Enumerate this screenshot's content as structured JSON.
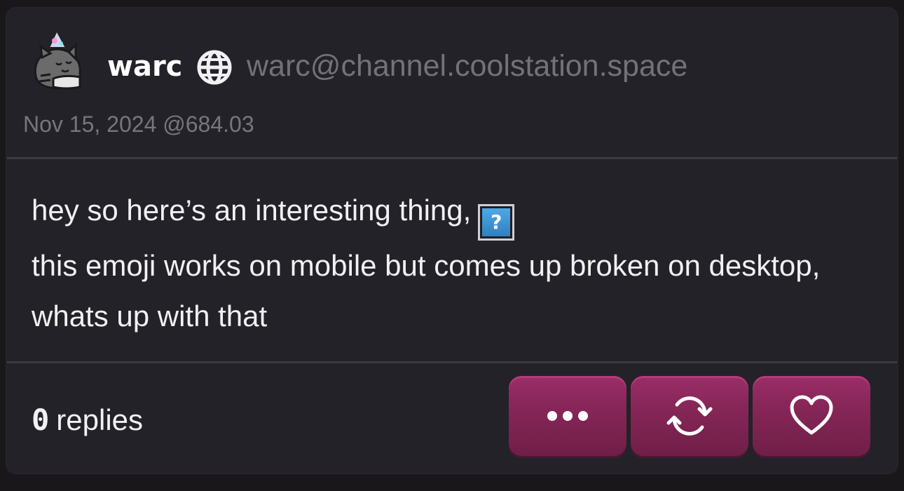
{
  "post": {
    "author": {
      "display_name": "warc",
      "handle": "warc@channel.coolstation.space",
      "avatar_icon": "cat-party-hat-avatar",
      "instance_icon": "globe-icon"
    },
    "timestamp": "Nov 15, 2024 @684.03",
    "body": {
      "line1": "hey so here’s an interesting thing,",
      "emoji_placeholder": "?",
      "line2": "this emoji works on mobile but comes up broken on desktop, whats up with that"
    },
    "replies": {
      "count": "0",
      "label": "replies"
    },
    "actions": [
      {
        "name": "more-options",
        "icon": "ellipsis-icon"
      },
      {
        "name": "repost",
        "icon": "repost-icon"
      },
      {
        "name": "like",
        "icon": "heart-icon"
      }
    ]
  },
  "colors": {
    "card_background": "#232228",
    "page_background": "#1a171b",
    "handle": "#737276",
    "timestamp": "#77767a",
    "accent_button": "#862657"
  }
}
